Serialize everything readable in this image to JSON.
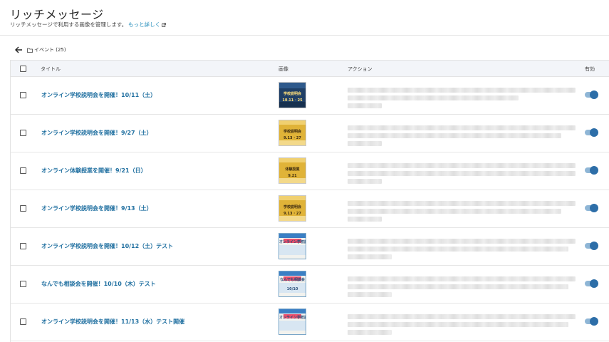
{
  "header": {
    "title": "リッチメッセージ",
    "description": "リッチメッセージで利用する画像を管理します。",
    "more_link": "もっと詳しく",
    "external_icon": "external-link-icon"
  },
  "breadcrumb": {
    "back_icon": "arrow-left-icon",
    "folder_icon": "folder-icon",
    "label": "イベント (25)"
  },
  "table": {
    "columns": {
      "title": "タイトル",
      "image": "画像",
      "action": "アクション",
      "enabled": "有効"
    },
    "rows": [
      {
        "title": "オンライン学校説明会を開催！10/11（土）",
        "thumb_style": "navy",
        "thumb_text": "学校説明会",
        "thumb_date": "10.11 · 25",
        "enabled": true
      },
      {
        "title": "オンライン学校説明会を開催！9/27（土）",
        "thumb_style": "yellow",
        "thumb_text": "学校説明会",
        "thumb_date": "9.13 · 27",
        "enabled": true
      },
      {
        "title": "オンライン体験授業を開催！9/21（日）",
        "thumb_style": "yellow",
        "thumb_text": "体験授業",
        "thumb_date": "9.21",
        "enabled": true
      },
      {
        "title": "オンライン学校説明会を開催！9/13（土）",
        "thumb_style": "yellow",
        "thumb_text": "学校説明会",
        "thumb_date": "9.13 · 27",
        "enabled": true
      },
      {
        "title": "オンライン学校説明会を開催！10/12（土）テスト",
        "thumb_style": "light",
        "thumb_text": "オンライン学校説明会",
        "thumb_date": "",
        "enabled": true
      },
      {
        "title": "なんでも相談会を開催！10/10（木）テスト",
        "thumb_style": "light",
        "thumb_text": "なんでも相談会",
        "thumb_date": "10/10",
        "enabled": true
      },
      {
        "title": "オンライン学校説明会を開催！11/13（水）テスト開催",
        "thumb_style": "light",
        "thumb_text": "オンライン学校説明会",
        "thumb_date": "",
        "enabled": true
      }
    ]
  },
  "colors": {
    "link": "#1f6fa0",
    "toggle_track": "#8fb6d6",
    "toggle_knob": "#2d6ea8",
    "header_bg": "#f3f5f9"
  }
}
